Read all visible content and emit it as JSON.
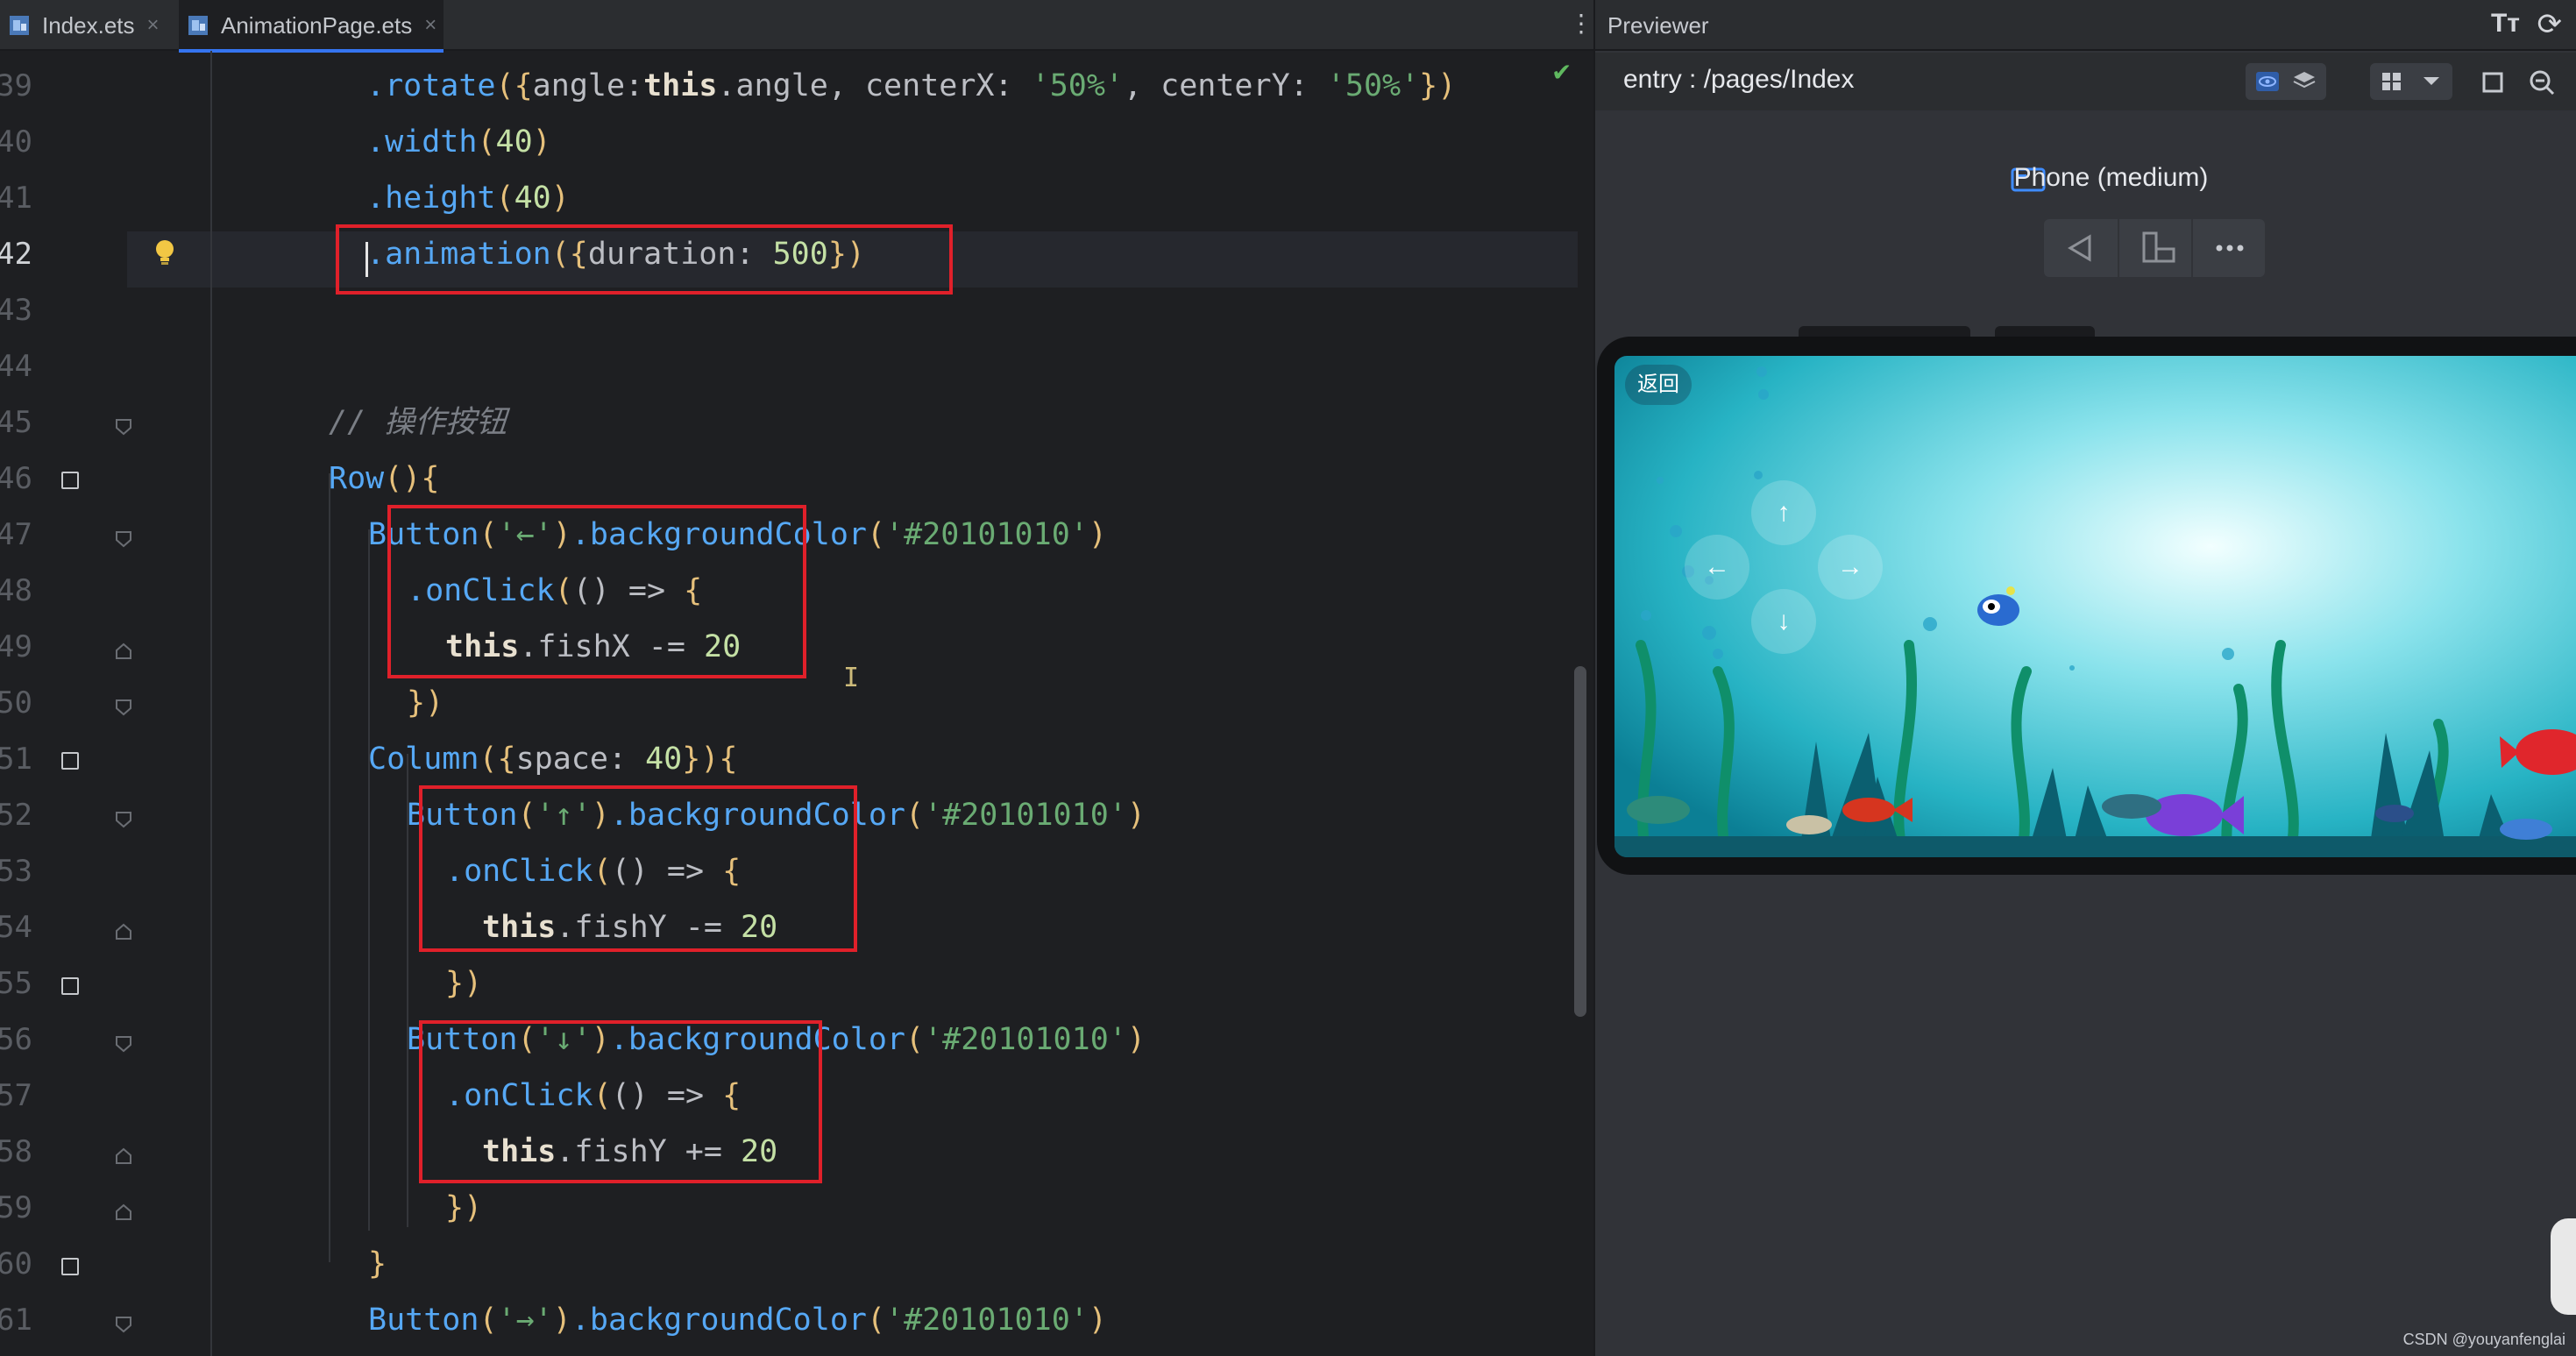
{
  "editor": {
    "tabs": [
      {
        "label": "Index.ets",
        "close": "×"
      },
      {
        "label": "AnimationPage.ets",
        "close": "×"
      }
    ],
    "menu": "⋮",
    "status_ok": "✔",
    "line_numbers": [
      "39",
      "40",
      "41",
      "42",
      "43",
      "44",
      "45",
      "46",
      "47",
      "48",
      "49",
      "50",
      "51",
      "52",
      "53",
      "54",
      "55",
      "56",
      "57",
      "58",
      "59",
      "60",
      "61"
    ],
    "current_line": "42",
    "text_cursor": "I"
  },
  "previewer": {
    "title": "Previewer",
    "font_button": "Tт",
    "refresh_button": "⟳",
    "path": "entry : /pages/Index",
    "device": "Phone (medium)",
    "app": {
      "back_label": "返回",
      "up": "↑",
      "down": "↓",
      "left": "←",
      "right": "→"
    }
  },
  "watermark": "CSDN @youyanfenglai",
  "colors": {
    "accent": "#3574f0",
    "highlight_box": "#e0202a",
    "editor_bg": "#1e1f22",
    "previewer_bg": "#313338"
  },
  "icons": [
    "file-icon",
    "close-icon",
    "more-vertical-icon",
    "lightbulb-icon",
    "fold-icon",
    "breakpoint-icon",
    "checkmark-icon",
    "font-size-icon",
    "refresh-icon",
    "eye-icon",
    "layers-icon",
    "grid-icon",
    "chevron-down-icon",
    "crop-icon",
    "zoom-out-icon",
    "phone-icon",
    "back-icon",
    "rotate-icon",
    "more-horizontal-icon"
  ]
}
